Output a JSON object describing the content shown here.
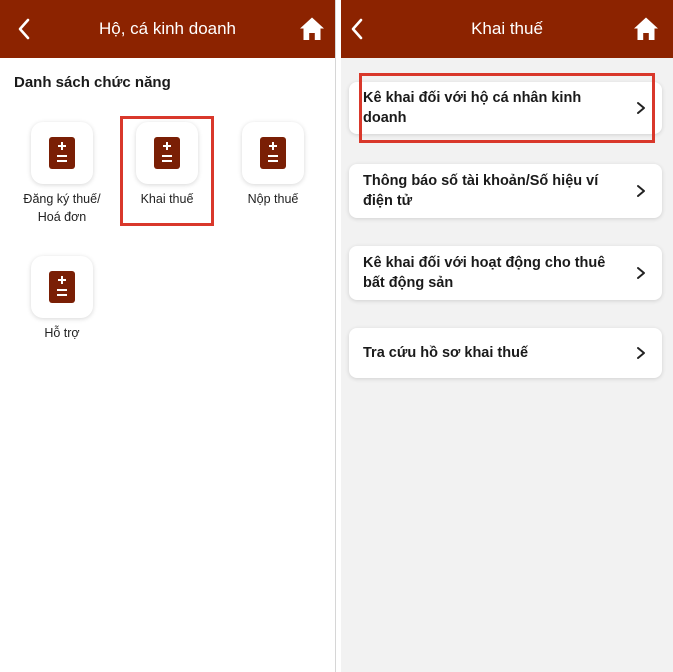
{
  "left_screen": {
    "header": {
      "title": "Hộ, cá kinh doanh",
      "back_icon": "chevron-left-icon",
      "home_icon": "home-icon"
    },
    "section_title": "Danh sách chức năng",
    "functions": [
      {
        "label": "Đăng ký thuế/ Hoá đơn",
        "icon": "document-icon"
      },
      {
        "label": "Khai thuế",
        "icon": "document-icon",
        "highlighted": true
      },
      {
        "label": "Nộp thuế",
        "icon": "document-icon"
      },
      {
        "label": "Hỗ trợ",
        "icon": "document-icon"
      }
    ]
  },
  "right_screen": {
    "header": {
      "title": "Khai thuế",
      "back_icon": "chevron-left-icon",
      "home_icon": "home-icon"
    },
    "items": [
      {
        "label": "Kê khai đối với hộ cá nhân kinh doanh",
        "highlighted": true
      },
      {
        "label": "Thông báo số tài khoản/Số hiệu ví điện tử"
      },
      {
        "label": "Kê khai đối với hoạt động cho thuê bất động sản"
      },
      {
        "label": "Tra cứu hồ sơ khai thuế"
      }
    ]
  },
  "colors": {
    "header_bg": "#8c2300",
    "icon_color": "#7a1f05",
    "highlight_border": "#d9382b",
    "right_screen_bg": "#f2f2f2"
  }
}
